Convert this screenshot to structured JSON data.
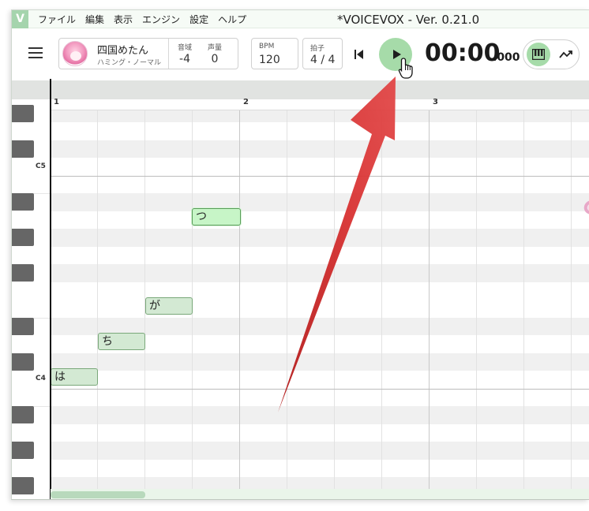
{
  "menubar": {
    "logo": "V",
    "items": [
      "ファイル",
      "編集",
      "表示",
      "エンジン",
      "設定",
      "ヘルプ"
    ],
    "title": "*VOICEVOX - Ver. 0.21.0"
  },
  "singer": {
    "name": "四国めたん",
    "style": "ハミング・ノーマル",
    "key_shift_label": "音域",
    "key_shift_value": "-4",
    "volume_label": "声量",
    "volume_value": "0"
  },
  "bpm": {
    "label": "BPM",
    "value": "120"
  },
  "beat": {
    "label": "拍子",
    "value": "4 / 4"
  },
  "time": {
    "main": "00:00",
    "ms": ".000"
  },
  "ruler": {
    "bars": [
      "1",
      "2",
      "3"
    ]
  },
  "keys": {
    "c5": "C5",
    "c4": "C4"
  },
  "notes": [
    {
      "lyric": "は",
      "selected": false
    },
    {
      "lyric": "ち",
      "selected": false
    },
    {
      "lyric": "が",
      "selected": false
    },
    {
      "lyric": "つ",
      "selected": true
    }
  ],
  "colors": {
    "accent": "#a6dba9",
    "note_fill": "#d3e9d3",
    "annotation_arrow": "#d22c2c"
  },
  "icons": {
    "menu": "hamburger-icon",
    "rewind": "skip-previous-icon",
    "play": "play-icon",
    "piano_mode": "piano-icon",
    "curve_mode": "trending-curve-icon",
    "cursor": "hand-pointer-icon"
  }
}
